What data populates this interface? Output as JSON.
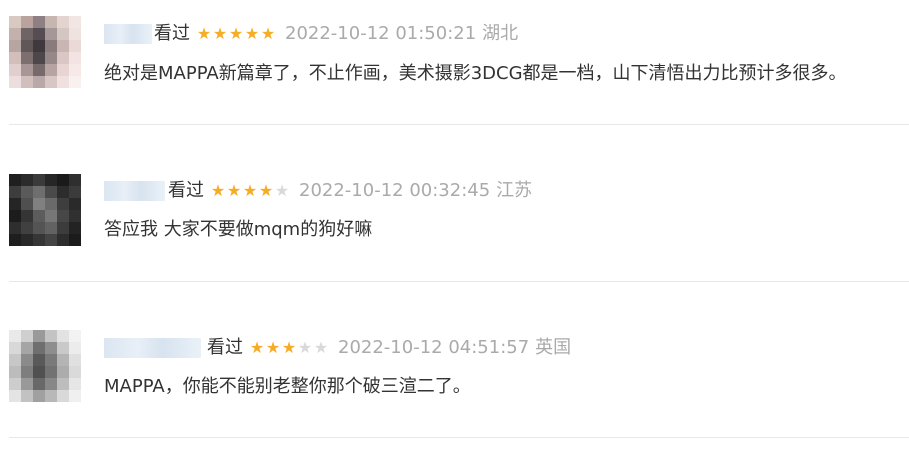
{
  "comments": [
    {
      "status": "看过",
      "rating": 5,
      "time": "2022-10-12 01:50:21",
      "region": "湖北",
      "text": "绝对是MAPPA新篇章了，不止作画，美术摄影3DCG都是一档，山下清悟出力比预计多很多。",
      "avatar_colors": [
        "#d8c9c1",
        "#b9a39c",
        "#8d7f83",
        "#c7b5b0",
        "#e3d4cf",
        "#f1e6e4",
        "#c4b1ad",
        "#6e6466",
        "#554d52",
        "#a59697",
        "#d6c6c3",
        "#efe3e0",
        "#b7a5a2",
        "#5f575a",
        "#3f393d",
        "#8a7c7d",
        "#c9b6b3",
        "#ead9d6",
        "#d2bfbc",
        "#7d6f70",
        "#4d464a",
        "#978888",
        "#dac6c4",
        "#f3e3e2",
        "#e0cfcd",
        "#a89696",
        "#766a6b",
        "#b6a3a2",
        "#e7d4d3",
        "#f6e9e8",
        "#ecdede",
        "#d1bfbe",
        "#b9a8a8",
        "#d8c6c5",
        "#f0e1e0",
        "#f9f0f0"
      ]
    },
    {
      "status": "看过",
      "rating": 4,
      "time": "2022-10-12 00:32:45",
      "region": "江苏",
      "text": "答应我 大家不要做mqm的狗好嘛",
      "avatar_colors": [
        "#1f1f1f",
        "#2b2b2b",
        "#3a3a3a",
        "#262626",
        "#1a1a1a",
        "#2f2f2f",
        "#3d3d3d",
        "#5a5a5a",
        "#6e6e6e",
        "#4a4a4a",
        "#2c2c2c",
        "#3b3b3b",
        "#252525",
        "#4f4f4f",
        "#808080",
        "#6a6a6a",
        "#3e3e3e",
        "#2a2a2a",
        "#1c1c1c",
        "#353535",
        "#5c5c5c",
        "#777777",
        "#474747",
        "#303030",
        "#2e2e2e",
        "#404040",
        "#545454",
        "#626262",
        "#3c3c3c",
        "#232323",
        "#1e1e1e",
        "#292929",
        "#363636",
        "#444444",
        "#2d2d2d",
        "#1b1b1b"
      ]
    },
    {
      "status": "看过",
      "rating": 3,
      "time": "2022-10-12 04:51:57",
      "region": "英国",
      "text": "MAPPA，你能不能别老整你那个破三渲二了。",
      "avatar_colors": [
        "#e9e9e9",
        "#cfcfcf",
        "#9a9a9a",
        "#c4c4c4",
        "#e2e2e2",
        "#f2f2f2",
        "#d8d8d8",
        "#a5a5a5",
        "#6f6f6f",
        "#8e8e8e",
        "#c9c9c9",
        "#ececec",
        "#c7c7c7",
        "#8b8b8b",
        "#595959",
        "#7a7a7a",
        "#b4b4b4",
        "#e0e0e0",
        "#bcbcbc",
        "#7e7e7e",
        "#505050",
        "#727272",
        "#acacac",
        "#dadada",
        "#cdcdcd",
        "#999999",
        "#686868",
        "#878787",
        "#bdbdbd",
        "#e6e6e6",
        "#e4e4e4",
        "#c2c2c2",
        "#a0a0a0",
        "#b8b8b8",
        "#d9d9d9",
        "#f0f0f0"
      ]
    }
  ]
}
